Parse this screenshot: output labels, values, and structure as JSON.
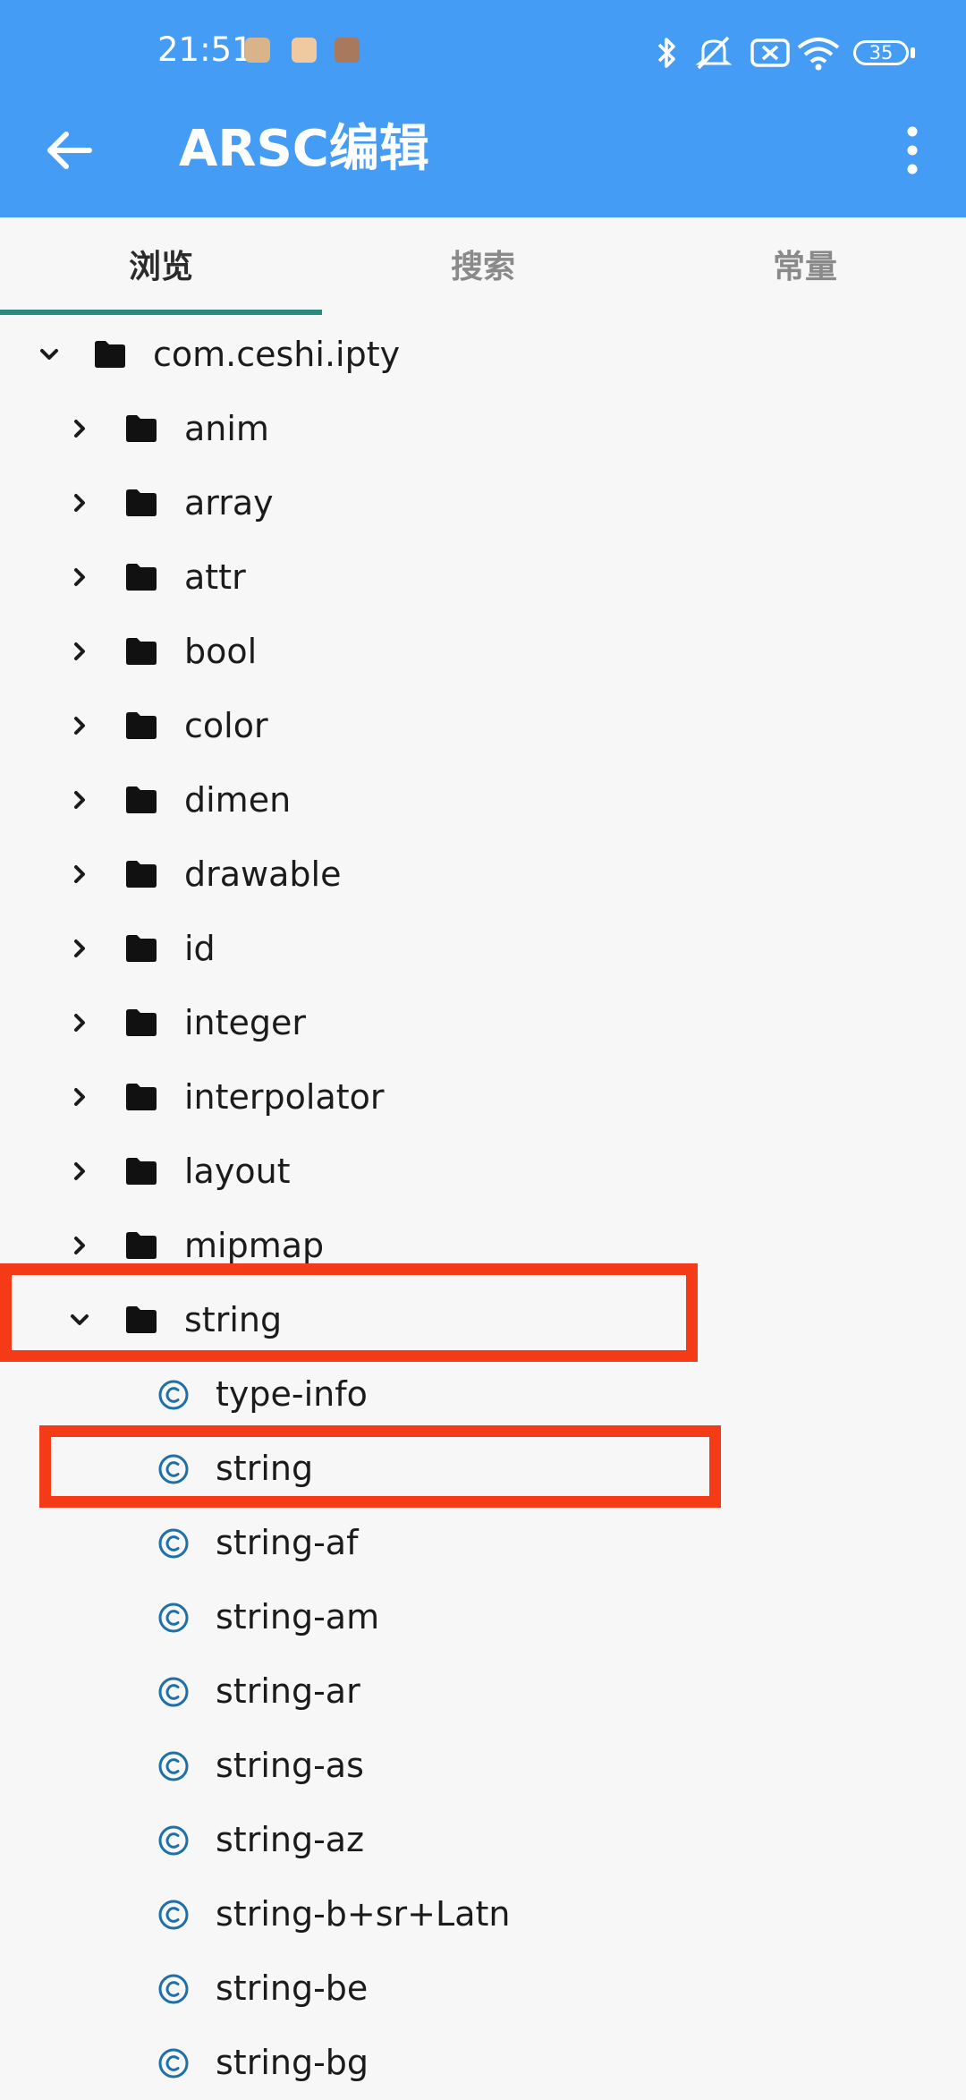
{
  "status_bar": {
    "time": "21:51",
    "battery": "35",
    "icons": [
      "bluetooth-icon",
      "silent-icon",
      "no-sim-icon",
      "wifi-icon",
      "battery-icon"
    ]
  },
  "toolbar": {
    "title": "ARSC编辑",
    "back_icon": "arrow-left-icon",
    "menu_icon": "more-vert-icon",
    "color": "#459cf5"
  },
  "tabs": [
    {
      "label": "浏览",
      "active": true
    },
    {
      "label": "搜索",
      "active": false
    },
    {
      "label": "常量",
      "active": false
    }
  ],
  "tree": {
    "root": "com.ceshi.ipty",
    "folders": [
      "anim",
      "array",
      "attr",
      "bool",
      "color",
      "dimen",
      "drawable",
      "id",
      "integer",
      "interpolator",
      "layout",
      "mipmap"
    ],
    "expanded_folder": "string",
    "children": [
      "type-info",
      "string",
      "string-af",
      "string-am",
      "string-ar",
      "string-as",
      "string-az",
      "string-b+sr+Latn",
      "string-be",
      "string-bg"
    ]
  },
  "highlight_color": "#f43a16",
  "accent_color": "#2a8a7c"
}
